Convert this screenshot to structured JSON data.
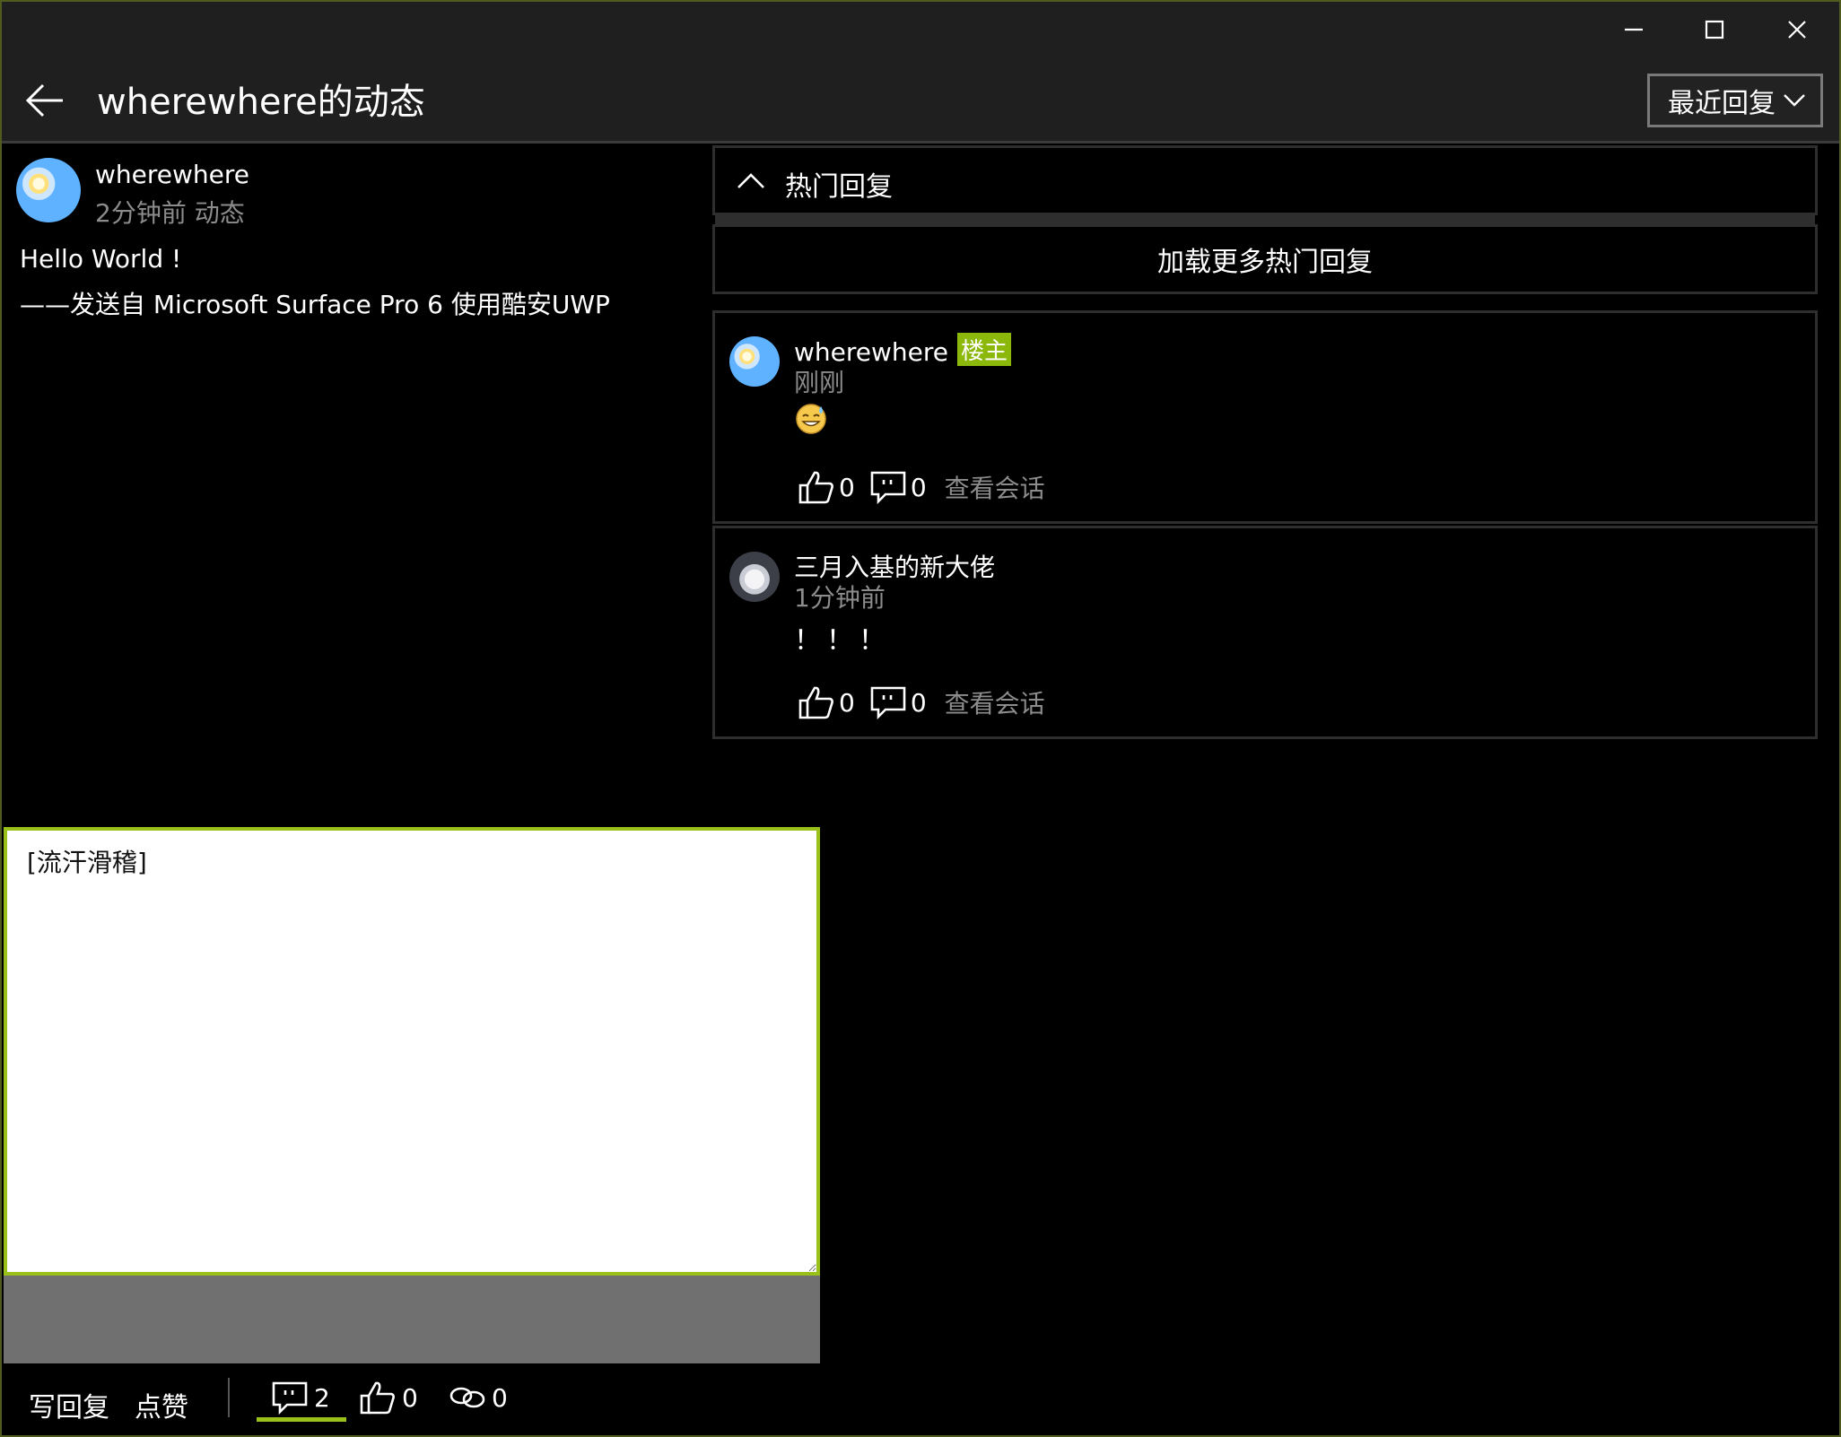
{
  "window": {
    "minimize_icon": "minimize-icon",
    "maximize_icon": "maximize-icon",
    "close_icon": "close-icon"
  },
  "header": {
    "title": "wherewhere的动态",
    "sort_selected": "最近回复"
  },
  "post": {
    "author": "wherewhere",
    "meta": "2分钟前  动态",
    "line1": "Hello World !",
    "line2": "——发送自 Microsoft Surface Pro 6 使用酷安UWP"
  },
  "hot_replies": {
    "header_label": "热门回复",
    "load_more": "加载更多热门回复"
  },
  "replies": [
    {
      "name": "wherewhere",
      "badge": "楼主",
      "time": "刚刚",
      "text": "",
      "likes": "0",
      "comments": "0",
      "view_conversation": "查看会话"
    },
    {
      "name": "三月入基的新大佬",
      "badge": "",
      "time": "1分钟前",
      "text": "！！！",
      "likes": "0",
      "comments": "0",
      "view_conversation": "查看会话"
    }
  ],
  "reply_input": {
    "value": "[流汗滑稽]"
  },
  "bottom_bar": {
    "write_reply": "写回复",
    "like": "点赞",
    "comments_count": "2",
    "likes_count": "0",
    "shares_count": "0"
  },
  "colors": {
    "accent": "#9ac11a",
    "owner_badge": "#8bb80a",
    "background": "#000000",
    "secondary_text": "#8c8c8c"
  }
}
